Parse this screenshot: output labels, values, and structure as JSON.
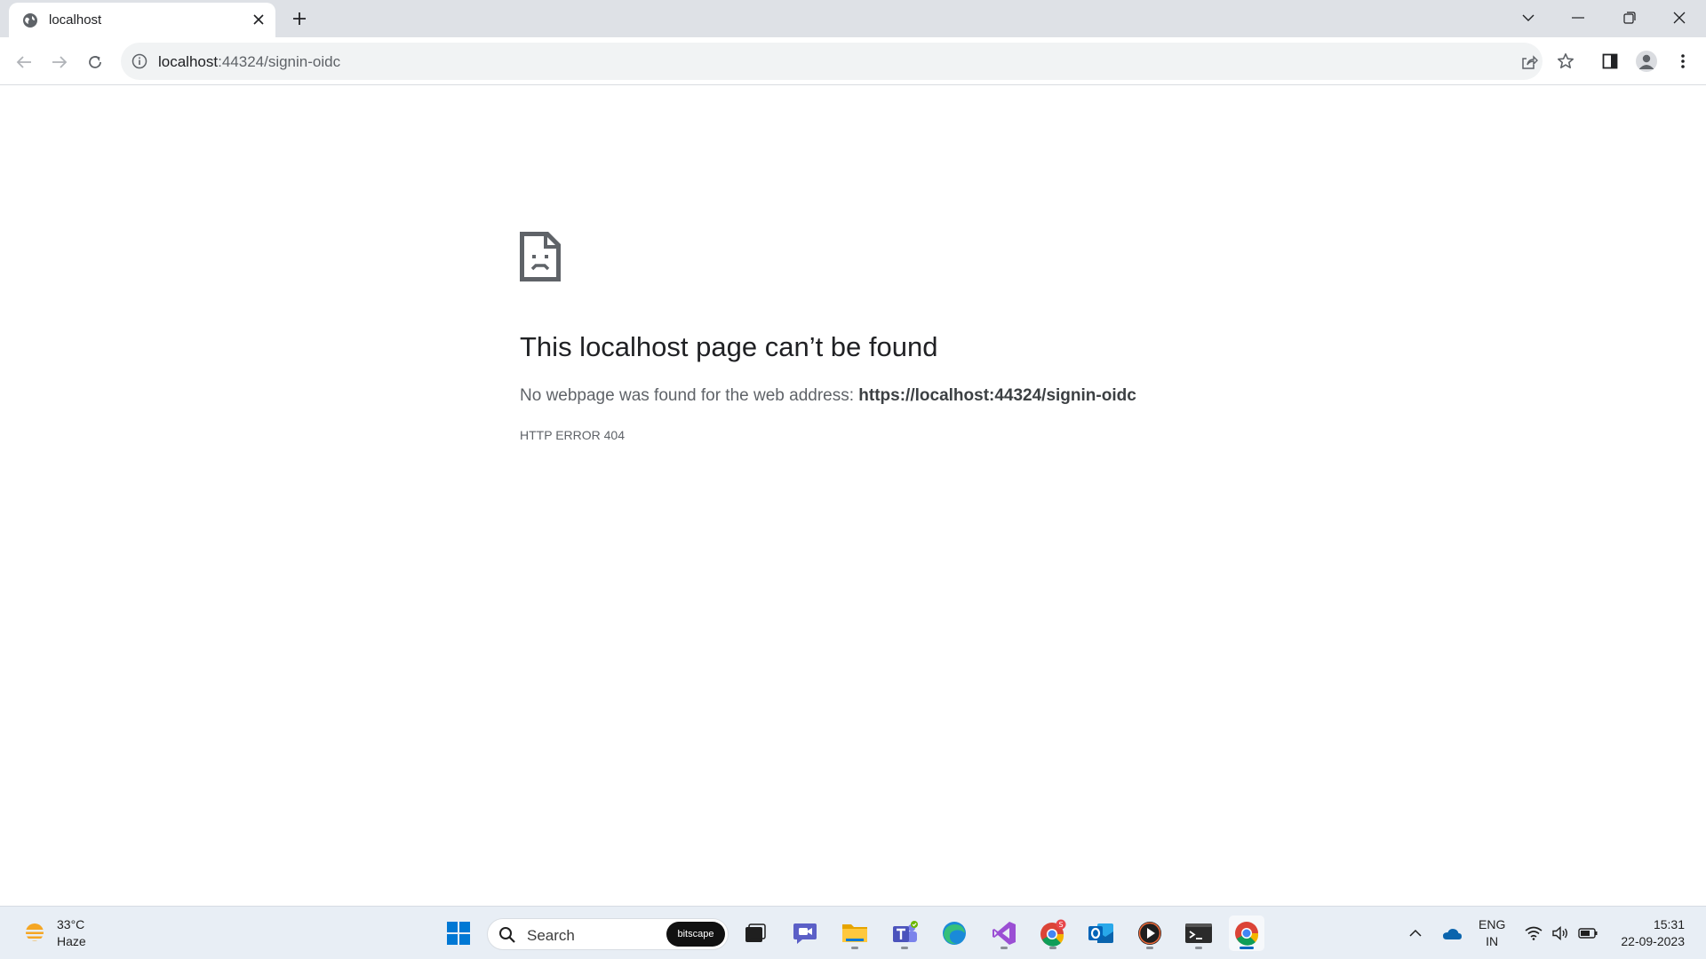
{
  "browser": {
    "tab": {
      "title": "localhost"
    },
    "address": {
      "host": "localhost",
      "path": ":44324/signin-oidc"
    }
  },
  "error_page": {
    "heading": "This localhost page can’t be found",
    "message_prefix": "No webpage was found for the web address: ",
    "message_url": "https://localhost:44324/signin-oidc",
    "code": "HTTP ERROR 404"
  },
  "taskbar": {
    "weather": {
      "temp": "33°C",
      "desc": "Haze"
    },
    "search": {
      "label": "Search",
      "badge": "bitscape"
    },
    "apps": [
      "Start",
      "Search",
      "Task View",
      "Meet",
      "File Explorer",
      "Teams",
      "Edge",
      "Visual Studio",
      "Chrome Profile",
      "Outlook",
      "Media Player",
      "Terminal",
      "Chrome"
    ],
    "tray": {
      "lang": "ENG",
      "region": "IN",
      "time": "15:31",
      "date": "22-09-2023"
    }
  },
  "colors": {
    "tabstrip": "#dee1e6",
    "omnibox": "#f1f3f4",
    "heading": "#202124",
    "body_text": "#5f6368",
    "taskbar": "#e8eef5",
    "accent": "#0067c0"
  }
}
